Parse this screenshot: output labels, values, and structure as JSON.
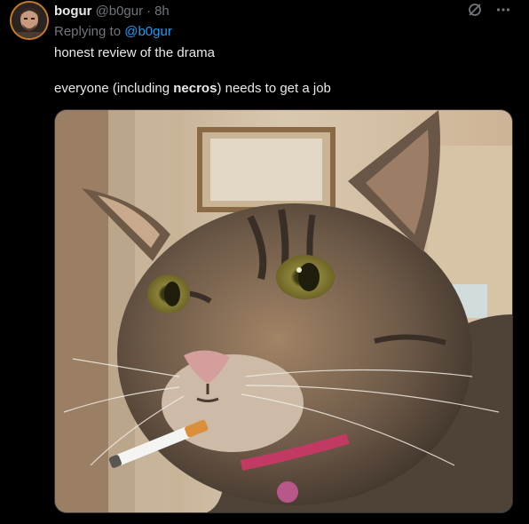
{
  "tweet": {
    "display_name": "bogur",
    "handle": "@b0gur",
    "separator": "·",
    "time": "8h",
    "replying_prefix": "Replying to",
    "replying_handle": "@b0gur",
    "line1": "honest review of the drama",
    "line2_before": "everyone (including ",
    "line2_bold": "necros",
    "line2_after": ") needs to get a job",
    "image_alt": "Tabby cat with a cigarette edited into its mouth"
  },
  "icons": {
    "avatar": "profile-picture",
    "grok": "grok-icon",
    "more": "more-icon"
  },
  "colors": {
    "background": "#000000",
    "primary_text": "#e7e9ea",
    "secondary_text": "#71767b",
    "link": "#1d9bf0"
  }
}
